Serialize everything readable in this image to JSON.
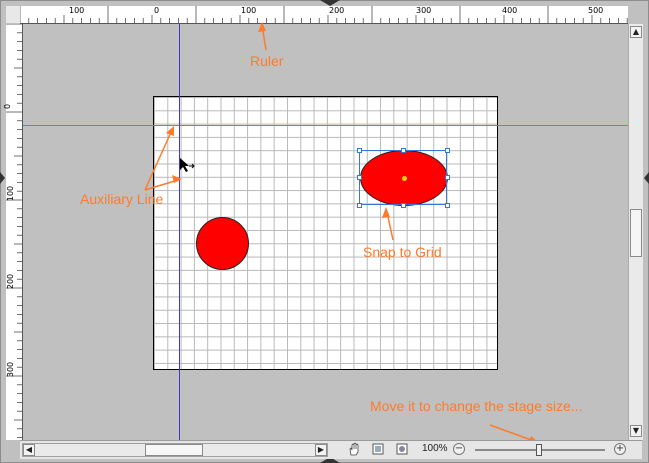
{
  "ruler": {
    "top_labels": [
      "100",
      "0",
      "100",
      "200",
      "300",
      "400",
      "500"
    ],
    "left_labels": [
      "0",
      "100",
      "200",
      "300"
    ]
  },
  "annotations": {
    "ruler": "Ruler",
    "auxiliary_line": "Auxiliary Line",
    "snap_to_grid": "Snap to Grid",
    "stage_size": "Move it to change the stage size..."
  },
  "toolbar": {
    "zoom_value": "100%",
    "zoom_out_symbol": "−",
    "zoom_in_symbol": "+",
    "hand_tool_icon": "hand-icon",
    "fit_icon": "fit-page-icon",
    "actual_size_icon": "actual-size-icon"
  },
  "scrollbar": {
    "up_arrow": "▲",
    "down_arrow": "▼",
    "left_arrow": "◀",
    "right_arrow": "▶"
  },
  "colors": {
    "annotation": "#ff7a2a",
    "horizontal_guide": "#29c02b",
    "vertical_guide": "#3a3acb",
    "shape_fill": "#ff0000",
    "selection": "#3a74d8"
  }
}
